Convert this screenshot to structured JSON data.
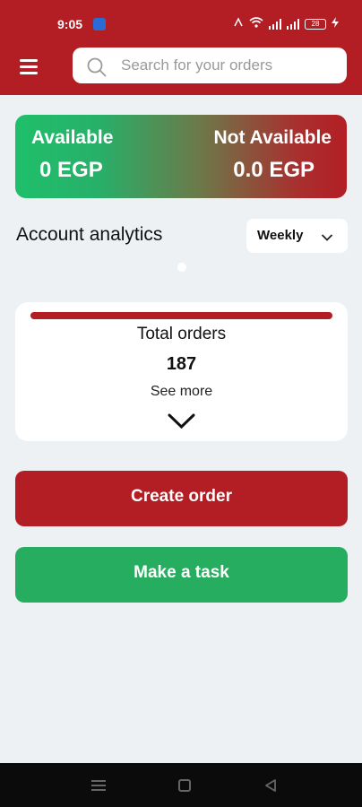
{
  "status_bar": {
    "time": "9:05",
    "battery": "28"
  },
  "header": {
    "menu_icon": "hamburger-menu-icon",
    "search_placeholder": "Search for your orders",
    "search_icon": "search-icon"
  },
  "balance": {
    "available_label": "Available",
    "available_value": "0 EGP",
    "not_available_label": "Not Available",
    "not_available_value": "0.0 EGP"
  },
  "analytics": {
    "title": "Account analytics",
    "period": "Weekly"
  },
  "orders_card": {
    "title": "Total orders",
    "count": "187",
    "see_more": "See more"
  },
  "actions": {
    "create_order": "Create order",
    "make_task": "Make a task"
  },
  "colors": {
    "brand_red": "#b31e24",
    "brand_green": "#27ad5f",
    "background": "#eef1f3"
  }
}
